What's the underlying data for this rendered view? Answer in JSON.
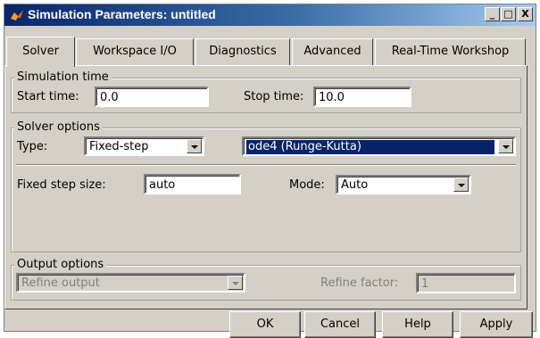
{
  "window": {
    "title": "Simulation Parameters: untitled",
    "controls": {
      "minimize": "_",
      "maximize": "□",
      "close": "X"
    }
  },
  "tabs": [
    {
      "label": "Solver",
      "active": true
    },
    {
      "label": "Workspace I/O",
      "active": false
    },
    {
      "label": "Diagnostics",
      "active": false
    },
    {
      "label": "Advanced",
      "active": false
    },
    {
      "label": "Real-Time Workshop",
      "active": false
    }
  ],
  "simulation_time": {
    "group_label": "Simulation time",
    "start_label": "Start time:",
    "start_value": "0.0",
    "stop_label": "Stop time:",
    "stop_value": "10.0"
  },
  "solver_options": {
    "group_label": "Solver options",
    "type_label": "Type:",
    "type_value": "Fixed-step",
    "solver_value": "ode4 (Runge-Kutta)",
    "step_label": "Fixed step size:",
    "step_value": "auto",
    "mode_label": "Mode:",
    "mode_value": "Auto"
  },
  "output_options": {
    "group_label": "Output options",
    "output_value": "Refine output",
    "refine_label": "Refine factor:",
    "refine_value": "1"
  },
  "buttons": {
    "ok": "OK",
    "cancel": "Cancel",
    "help": "Help",
    "apply": "Apply"
  },
  "colors": {
    "face": "#d4d0c8",
    "title_active": "#0a246a",
    "selection": "#0a246a"
  }
}
